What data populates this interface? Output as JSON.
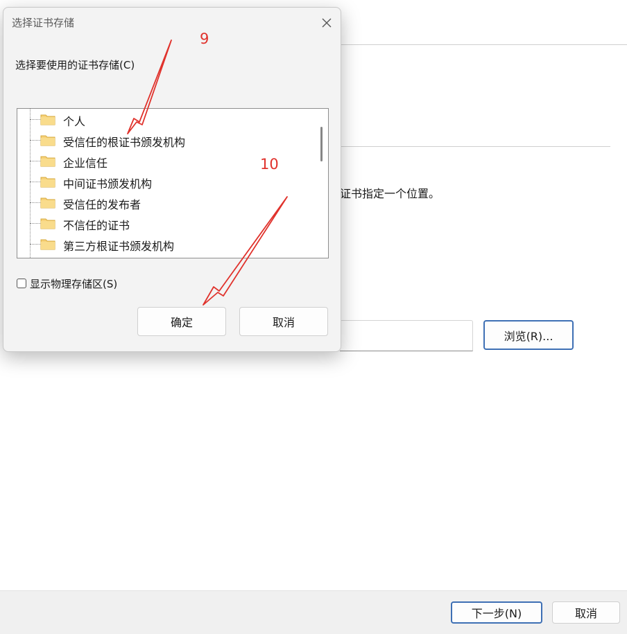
{
  "wizard": {
    "description_tail": "证书指定一个位置。",
    "browse_label": "浏览(R)...",
    "next_label": "下一步(N)",
    "cancel_label": "取消"
  },
  "dialog": {
    "title": "选择证书存储",
    "store_label": "选择要使用的证书存储(C)",
    "stores": [
      {
        "label": "个人"
      },
      {
        "label": "受信任的根证书颁发机构"
      },
      {
        "label": "企业信任"
      },
      {
        "label": "中间证书颁发机构"
      },
      {
        "label": "受信任的发布者"
      },
      {
        "label": "不信任的证书"
      },
      {
        "label": "第三方根证书颁发机构"
      }
    ],
    "show_physical_label": "显示物理存储区(S)",
    "show_physical_checked": false,
    "ok_label": "确定",
    "cancel_label": "取消"
  },
  "annotations": {
    "step_9": "9",
    "step_10": "10",
    "color": "#e0322c"
  },
  "colors": {
    "accent_border": "#3d6fb4",
    "folder_fill": "#f7d27a"
  }
}
